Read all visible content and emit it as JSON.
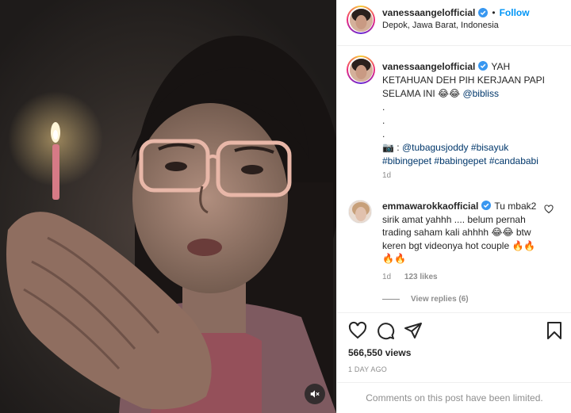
{
  "colors": {
    "accent": "#0095f6",
    "link": "#00376b",
    "muted": "#8e8e8e",
    "text": "#262626",
    "verified": "#3897f0",
    "flame": "#f07830"
  },
  "header": {
    "username": "vanessaangelofficial",
    "separator": "•",
    "follow_label": "Follow",
    "location": "Depok, Jawa Barat, Indonesia"
  },
  "caption": {
    "username": "vanessaangelofficial",
    "text": "YAH KETAHUAN DEH PIH KERJAAN PAPI SELAMA INI",
    "emojis": "😂😂",
    "mention": "@bibliss",
    "dots": [
      ".",
      ".",
      "."
    ],
    "camera_emoji": "📷",
    "credit_separator": " : ",
    "credit_mention": "@tubagusjoddy",
    "hashtags": [
      "#bisayuk",
      "#bibingepet",
      "#babingepet",
      "#candababi"
    ],
    "time": "1d"
  },
  "comment": {
    "username": "emmawarokkaofficial",
    "text_part1": "Tu mbak2 sirik amat yahhh .... belum pernah trading saham kali ahhhh",
    "emojis_1": "😂😂",
    "text_part2": "btw keren bgt videonya hot couple",
    "emojis_2": "🔥🔥🔥🔥",
    "time": "1d",
    "likes": "123 likes",
    "view_replies": "View replies (6)"
  },
  "actions": {
    "icons": [
      "heart-icon",
      "comment-icon",
      "share-icon",
      "bookmark-icon"
    ],
    "views": "566,550 views",
    "post_time": "1 DAY AGO"
  },
  "footer": {
    "limited_text": "Comments on this post have been limited."
  },
  "video": {
    "mute_icon": "speaker-muted-icon"
  }
}
